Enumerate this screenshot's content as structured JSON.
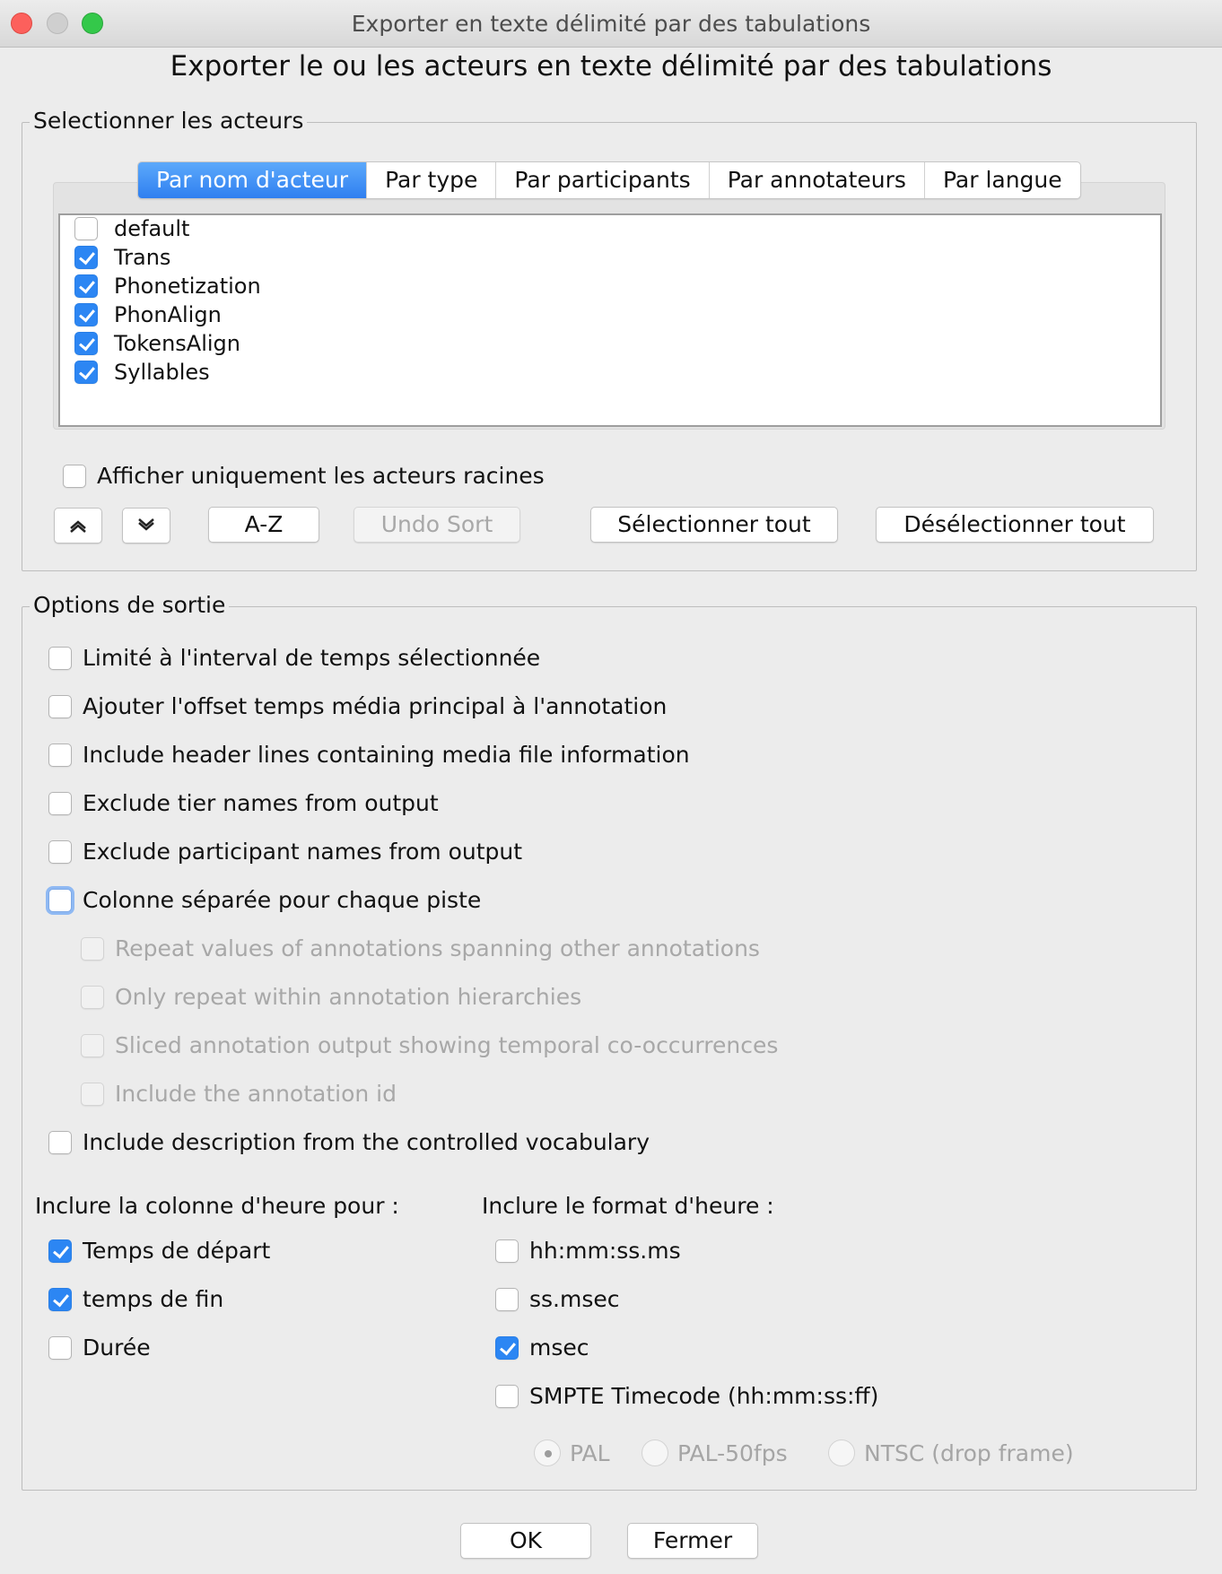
{
  "window": {
    "title": "Exporter en texte délimité par des tabulations",
    "heading": "Exporter le ou les acteurs en texte délimité par des tabulations"
  },
  "select_group": {
    "title": "Selectionner les acteurs",
    "tabs": [
      {
        "label": "Par nom d'acteur",
        "active": true
      },
      {
        "label": "Par type",
        "active": false
      },
      {
        "label": "Par participants",
        "active": false
      },
      {
        "label": "Par annotateurs",
        "active": false
      },
      {
        "label": "Par langue",
        "active": false
      }
    ],
    "tiers": [
      {
        "label": "default",
        "checked": false
      },
      {
        "label": "Trans",
        "checked": true
      },
      {
        "label": "Phonetization",
        "checked": true
      },
      {
        "label": "PhonAlign",
        "checked": true
      },
      {
        "label": "TokensAlign",
        "checked": true
      },
      {
        "label": "Syllables",
        "checked": true
      }
    ],
    "root_only": {
      "label": "Afficher uniquement les acteurs racines",
      "checked": false
    },
    "buttons": {
      "move_up_icon": "chevron-up-icon",
      "move_down_icon": "chevron-down-icon",
      "sort_az": "A-Z",
      "undo_sort": "Undo Sort",
      "select_all": "Sélectionner tout",
      "deselect_all": "Désélectionner tout"
    }
  },
  "output_group": {
    "title": "Options de sortie",
    "options": [
      {
        "label": "Limité à l'interval de temps sélectionnée",
        "checked": false,
        "enabled": true
      },
      {
        "label": "Ajouter l'offset temps média principal à l'annotation",
        "checked": false,
        "enabled": true
      },
      {
        "label": "Include header lines containing media file information",
        "checked": false,
        "enabled": true
      },
      {
        "label": "Exclude tier names from output",
        "checked": false,
        "enabled": true
      },
      {
        "label": "Exclude participant names from output",
        "checked": false,
        "enabled": true
      },
      {
        "label": "Colonne séparée pour chaque piste",
        "checked": false,
        "enabled": true,
        "focused": true
      },
      {
        "label": "Repeat values of annotations spanning other annotations",
        "checked": false,
        "enabled": false
      },
      {
        "label": "Only repeat within annotation hierarchies",
        "checked": false,
        "enabled": false
      },
      {
        "label": "Sliced annotation output showing temporal co-occurrences",
        "checked": false,
        "enabled": false
      },
      {
        "label": "Include the annotation id",
        "checked": false,
        "enabled": false
      },
      {
        "label": "Include description from the controlled vocabulary",
        "checked": false,
        "enabled": true
      }
    ],
    "time_columns": {
      "label": "Inclure la colonne d'heure pour :",
      "items": [
        {
          "label": "Temps de départ",
          "checked": true
        },
        {
          "label": "temps de fin",
          "checked": true
        },
        {
          "label": "Durée",
          "checked": false
        }
      ]
    },
    "time_format": {
      "label": "Inclure le format d'heure :",
      "items": [
        {
          "label": "hh:mm:ss.ms",
          "checked": false
        },
        {
          "label": "ss.msec",
          "checked": false
        },
        {
          "label": "msec",
          "checked": true
        },
        {
          "label": "SMPTE Timecode (hh:mm:ss:ff)",
          "checked": false
        }
      ],
      "smpte_modes": [
        {
          "label": "PAL",
          "selected": true
        },
        {
          "label": "PAL-50fps",
          "selected": false
        },
        {
          "label": "NTSC (drop frame)",
          "selected": false
        }
      ]
    }
  },
  "footer": {
    "ok": "OK",
    "close": "Fermer"
  },
  "colors": {
    "accent": "#2c86f3",
    "window_bg": "#ececec",
    "disabled_text": "#a8a8a8"
  }
}
